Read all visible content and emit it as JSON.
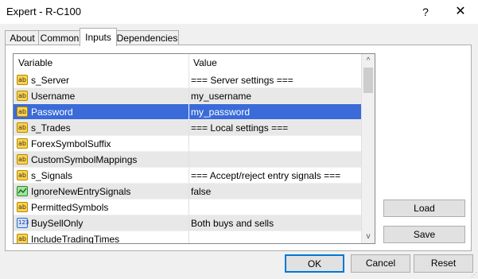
{
  "window": {
    "title": "Expert - R-C100",
    "help_glyph": "?",
    "close_glyph": "✕"
  },
  "tabs": [
    {
      "label": "About"
    },
    {
      "label": "Common"
    },
    {
      "label": "Inputs",
      "active": true
    },
    {
      "label": "Dependencies"
    }
  ],
  "grid": {
    "columns": {
      "variable": "Variable",
      "value": "Value"
    },
    "rows": [
      {
        "icon": "ab",
        "name": "s_Server",
        "value": "=== Server settings ==="
      },
      {
        "icon": "ab",
        "name": "Username",
        "value": "my_username"
      },
      {
        "icon": "ab",
        "name": "Password",
        "value": "my_password"
      },
      {
        "icon": "ab",
        "name": "s_Trades",
        "value": "=== Local settings ==="
      },
      {
        "icon": "ab",
        "name": "ForexSymbolSuffix",
        "value": ""
      },
      {
        "icon": "ab",
        "name": "CustomSymbolMappings",
        "value": ""
      },
      {
        "icon": "ab",
        "name": "s_Signals",
        "value": "=== Accept/reject entry signals ==="
      },
      {
        "icon": "bool",
        "name": "IgnoreNewEntrySignals",
        "value": "false"
      },
      {
        "icon": "ab",
        "name": "PermittedSymbols",
        "value": ""
      },
      {
        "icon": "123",
        "name": "BuySellOnly",
        "value": "Both buys and sells"
      },
      {
        "icon": "ab",
        "name": "IncludeTradingTimes",
        "value": ""
      }
    ],
    "selected_row": 2,
    "scroll_up_glyph": "^",
    "scroll_down_glyph": "v"
  },
  "side_buttons": {
    "load": "Load",
    "save": "Save"
  },
  "footer_buttons": {
    "ok": "OK",
    "cancel": "Cancel",
    "reset": "Reset"
  },
  "icons": {
    "ab": "string-param-icon",
    "bool": "boolean-param-icon",
    "123": "enum-param-icon"
  },
  "colors": {
    "selection": "#3a6bd9",
    "string_icon": "#ffd24a",
    "bool_icon": "#9ee39e"
  }
}
